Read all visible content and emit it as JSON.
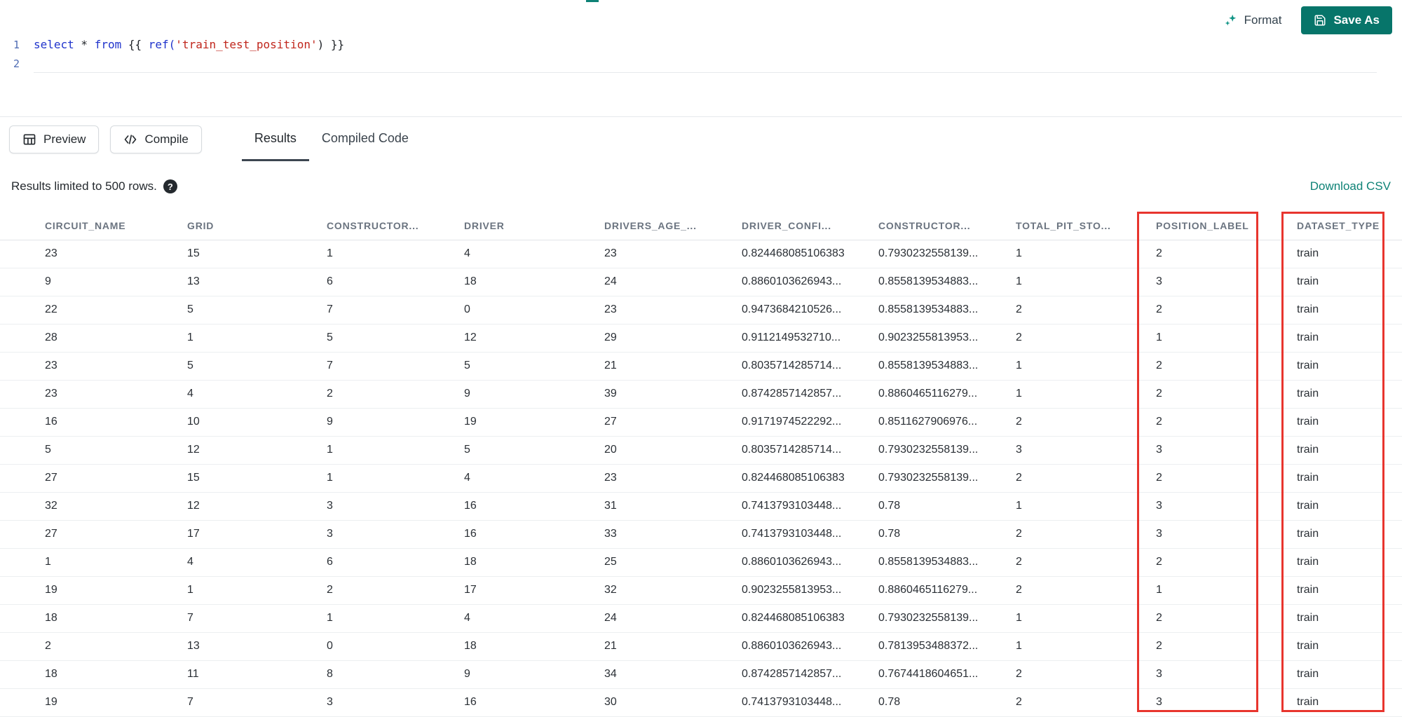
{
  "colors": {
    "accent": "#0e8276",
    "accent_dark": "#07756a",
    "highlight_red": "#e8352e",
    "keyword_blue": "#2034cc",
    "string_red": "#c0261c"
  },
  "toolbar": {
    "format_label": "Format",
    "save_as_label": "Save As"
  },
  "editor": {
    "lines": [
      {
        "number": "1"
      },
      {
        "number": "2"
      }
    ],
    "code": {
      "kw_select": "select",
      "star": " * ",
      "kw_from": "from",
      "open_braces": " {{ ",
      "fn_ref": "ref(",
      "string_arg": "'train_test_position'",
      "close_paren": ")",
      "close_braces": " }}"
    }
  },
  "actions": {
    "preview_label": "Preview",
    "compile_label": "Compile"
  },
  "tabs": [
    {
      "label": "Results",
      "active": true
    },
    {
      "label": "Compiled Code",
      "active": false
    }
  ],
  "results_bar": {
    "info": "Results limited to 500 rows.",
    "help_icon": "?",
    "download_label": "Download CSV"
  },
  "results_table": {
    "columns": [
      "CIRCUIT_NAME",
      "GRID",
      "CONSTRUCTOR...",
      "DRIVER",
      "DRIVERS_AGE_...",
      "DRIVER_CONFI...",
      "CONSTRUCTOR...",
      "TOTAL_PIT_STO...",
      "POSITION_LABEL",
      "DATASET_TYPE"
    ],
    "highlighted_columns": [
      "POSITION_LABEL",
      "DATASET_TYPE"
    ],
    "rows": [
      [
        "23",
        "15",
        "1",
        "4",
        "23",
        "0.824468085106383",
        "0.7930232558139...",
        "1",
        "2",
        "train"
      ],
      [
        "9",
        "13",
        "6",
        "18",
        "24",
        "0.8860103626943...",
        "0.8558139534883...",
        "1",
        "3",
        "train"
      ],
      [
        "22",
        "5",
        "7",
        "0",
        "23",
        "0.9473684210526...",
        "0.8558139534883...",
        "2",
        "2",
        "train"
      ],
      [
        "28",
        "1",
        "5",
        "12",
        "29",
        "0.9112149532710...",
        "0.9023255813953...",
        "2",
        "1",
        "train"
      ],
      [
        "23",
        "5",
        "7",
        "5",
        "21",
        "0.8035714285714...",
        "0.8558139534883...",
        "1",
        "2",
        "train"
      ],
      [
        "23",
        "4",
        "2",
        "9",
        "39",
        "0.8742857142857...",
        "0.8860465116279...",
        "1",
        "2",
        "train"
      ],
      [
        "16",
        "10",
        "9",
        "19",
        "27",
        "0.9171974522292...",
        "0.8511627906976...",
        "2",
        "2",
        "train"
      ],
      [
        "5",
        "12",
        "1",
        "5",
        "20",
        "0.8035714285714...",
        "0.7930232558139...",
        "3",
        "3",
        "train"
      ],
      [
        "27",
        "15",
        "1",
        "4",
        "23",
        "0.824468085106383",
        "0.7930232558139...",
        "2",
        "2",
        "train"
      ],
      [
        "32",
        "12",
        "3",
        "16",
        "31",
        "0.7413793103448...",
        "0.78",
        "1",
        "3",
        "train"
      ],
      [
        "27",
        "17",
        "3",
        "16",
        "33",
        "0.7413793103448...",
        "0.78",
        "2",
        "3",
        "train"
      ],
      [
        "1",
        "4",
        "6",
        "18",
        "25",
        "0.8860103626943...",
        "0.8558139534883...",
        "2",
        "2",
        "train"
      ],
      [
        "19",
        "1",
        "2",
        "17",
        "32",
        "0.9023255813953...",
        "0.8860465116279...",
        "2",
        "1",
        "train"
      ],
      [
        "18",
        "7",
        "1",
        "4",
        "24",
        "0.824468085106383",
        "0.7930232558139...",
        "1",
        "2",
        "train"
      ],
      [
        "2",
        "13",
        "0",
        "18",
        "21",
        "0.8860103626943...",
        "0.7813953488372...",
        "1",
        "2",
        "train"
      ],
      [
        "18",
        "11",
        "8",
        "9",
        "34",
        "0.8742857142857...",
        "0.7674418604651...",
        "2",
        "3",
        "train"
      ],
      [
        "19",
        "7",
        "3",
        "16",
        "30",
        "0.7413793103448...",
        "0.78",
        "2",
        "3",
        "train"
      ]
    ]
  }
}
